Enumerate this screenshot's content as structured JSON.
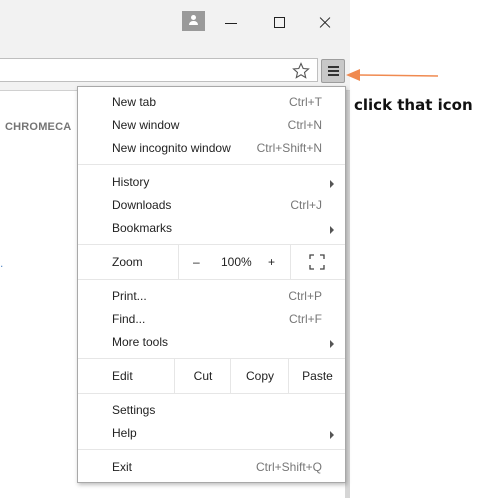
{
  "page": {
    "fragment_text": "CHROMECA",
    "fragment_dot": "."
  },
  "annotation": {
    "text": "click that icon",
    "arrow_color": "#f08a50"
  },
  "menu": {
    "items": {
      "new_tab": {
        "label": "New tab",
        "shortcut": "Ctrl+T"
      },
      "new_window": {
        "label": "New window",
        "shortcut": "Ctrl+N"
      },
      "new_incognito": {
        "label": "New incognito window",
        "shortcut": "Ctrl+Shift+N"
      },
      "history": {
        "label": "History"
      },
      "downloads": {
        "label": "Downloads",
        "shortcut": "Ctrl+J"
      },
      "bookmarks": {
        "label": "Bookmarks"
      },
      "print": {
        "label": "Print...",
        "shortcut": "Ctrl+P"
      },
      "find": {
        "label": "Find...",
        "shortcut": "Ctrl+F"
      },
      "more_tools": {
        "label": "More tools"
      },
      "settings": {
        "label": "Settings"
      },
      "help": {
        "label": "Help"
      },
      "exit": {
        "label": "Exit",
        "shortcut": "Ctrl+Shift+Q"
      }
    },
    "zoom": {
      "label": "Zoom",
      "minus": "–",
      "value": "100%",
      "plus": "+"
    },
    "edit": {
      "label": "Edit",
      "cut": "Cut",
      "copy": "Copy",
      "paste": "Paste"
    }
  },
  "icons": {
    "profile": "person-icon",
    "minimize": "minimize-icon",
    "maximize": "maximize-icon",
    "close": "close-icon",
    "bookmark_star": "star-icon",
    "menu": "hamburger-menu-icon",
    "fullscreen": "fullscreen-icon"
  }
}
